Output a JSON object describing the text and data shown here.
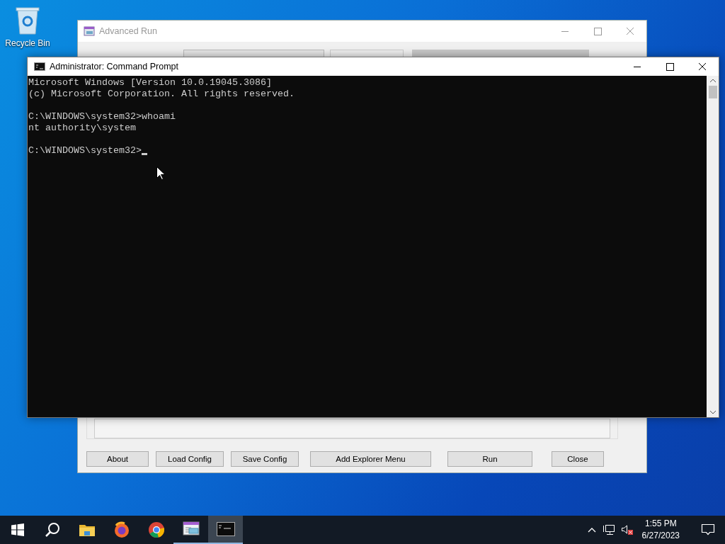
{
  "desktop_icons": [
    {
      "label": "Recycle Bin"
    }
  ],
  "background_window": {
    "title": "Advanced Run",
    "buttons": [
      "About",
      "Load Config",
      "Save Config",
      "Add Explorer Menu",
      "Run",
      "Close"
    ]
  },
  "console_window": {
    "title": "Administrator:  Command Prompt",
    "blocks": [
      [
        "Microsoft Windows [Version 10.0.19045.3086]",
        "(c) Microsoft Corporation. All rights reserved."
      ],
      [
        "C:\\WINDOWS\\system32>whoami",
        "nt authority\\system"
      ],
      [
        "C:\\WINDOWS\\system32>"
      ]
    ]
  },
  "taskbar": {
    "apps": [
      {
        "kind": "start",
        "selected": false,
        "running": false
      },
      {
        "kind": "search",
        "selected": false,
        "running": false
      },
      {
        "kind": "folder",
        "selected": false,
        "running": false
      },
      {
        "kind": "firefox",
        "selected": false,
        "running": false
      },
      {
        "kind": "chrome",
        "selected": false,
        "running": false
      },
      {
        "kind": "advancedrun",
        "selected": false,
        "running": true
      },
      {
        "kind": "console",
        "selected": true,
        "running": true
      }
    ],
    "clock": {
      "time": "1:55 PM",
      "date": "6/27/2023"
    }
  }
}
